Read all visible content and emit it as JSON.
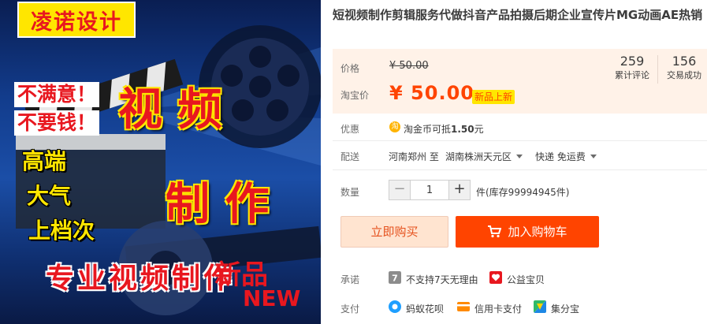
{
  "image": {
    "brand": "凌诺设计",
    "promo_line1": "不满意！",
    "promo_line2": "不要钱！",
    "promo_big1": "视 频",
    "promo_big2": "制 作",
    "promo_left1": "高端",
    "promo_left2": "大气",
    "promo_left3": "上档次",
    "promo_bottom": "专业视频制作",
    "new_top": "新品",
    "new_bottom": "NEW"
  },
  "product": {
    "title": "短视频制作剪辑服务代做抖音产品拍摄后期企业宣传片MG动画AE热销"
  },
  "price": {
    "price_label": "价格",
    "original_price": "¥ 50.00",
    "taobao_label": "淘宝价",
    "taobao_price": "¥ 50.00",
    "new_tag": "新品上新"
  },
  "stats": {
    "reviews_count": "259",
    "reviews_label": "累计评论",
    "sales_count": "156",
    "sales_label": "交易成功"
  },
  "promo": {
    "label": "优惠",
    "coin_icon": "淘",
    "coin_prefix": "淘金币可抵",
    "coin_amount": "1.50",
    "coin_suffix": "元"
  },
  "shipping": {
    "label": "配送",
    "from": "河南郑州 至",
    "to": "湖南株洲天元区",
    "method": "快递 免运费"
  },
  "quantity": {
    "label": "数量",
    "minus": "−",
    "value": "1",
    "plus": "+",
    "stock": "件(库存99994945件)"
  },
  "actions": {
    "buy_now": "立即购买",
    "add_to_cart": "加入购物车"
  },
  "promise": {
    "label": "承诺",
    "item1": "不支持7天无理由",
    "item2": "公益宝贝"
  },
  "payment": {
    "label": "支付",
    "item1": "蚂蚁花呗",
    "item2": "信用卡支付",
    "item3": "集分宝"
  },
  "colors": {
    "accent": "#ff4400",
    "panel_bg": "#fff2e8",
    "new_tag_bg": "#ffe600"
  }
}
